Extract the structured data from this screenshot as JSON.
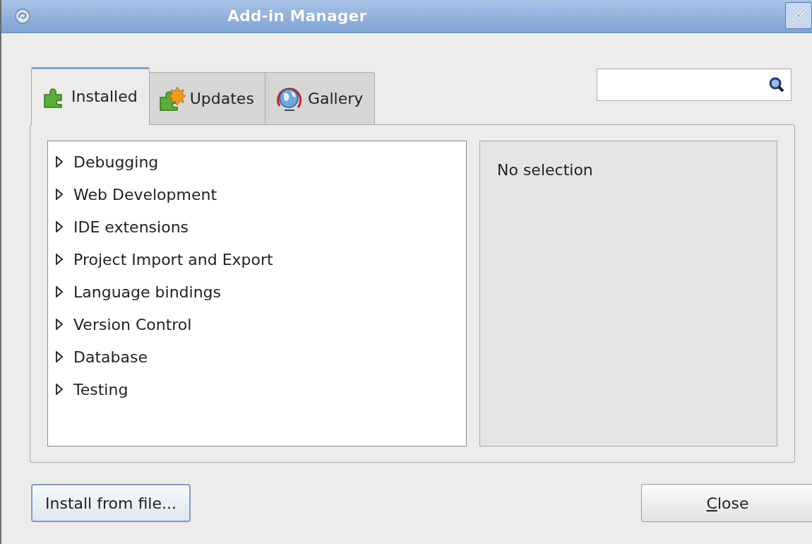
{
  "window": {
    "title": "Add-in Manager"
  },
  "tabs": [
    {
      "label": "Installed",
      "selected": true
    },
    {
      "label": "Updates",
      "selected": false
    },
    {
      "label": "Gallery",
      "selected": false
    }
  ],
  "tree": {
    "items": [
      {
        "label": "Debugging",
        "expanded": false
      },
      {
        "label": "Web Development",
        "expanded": false
      },
      {
        "label": "IDE extensions",
        "expanded": false
      },
      {
        "label": "Project Import and Export",
        "expanded": false
      },
      {
        "label": "Language bindings",
        "expanded": false
      },
      {
        "label": "Version Control",
        "expanded": false
      },
      {
        "label": "Database",
        "expanded": false
      },
      {
        "label": "Testing",
        "expanded": false
      }
    ]
  },
  "details": {
    "text": "No selection"
  },
  "buttons": [
    {
      "label": "Install from file...",
      "focused": true,
      "mnemonic_underlined": false
    },
    {
      "label": "Close",
      "focused": false,
      "mnemonic_underlined": true
    }
  ]
}
